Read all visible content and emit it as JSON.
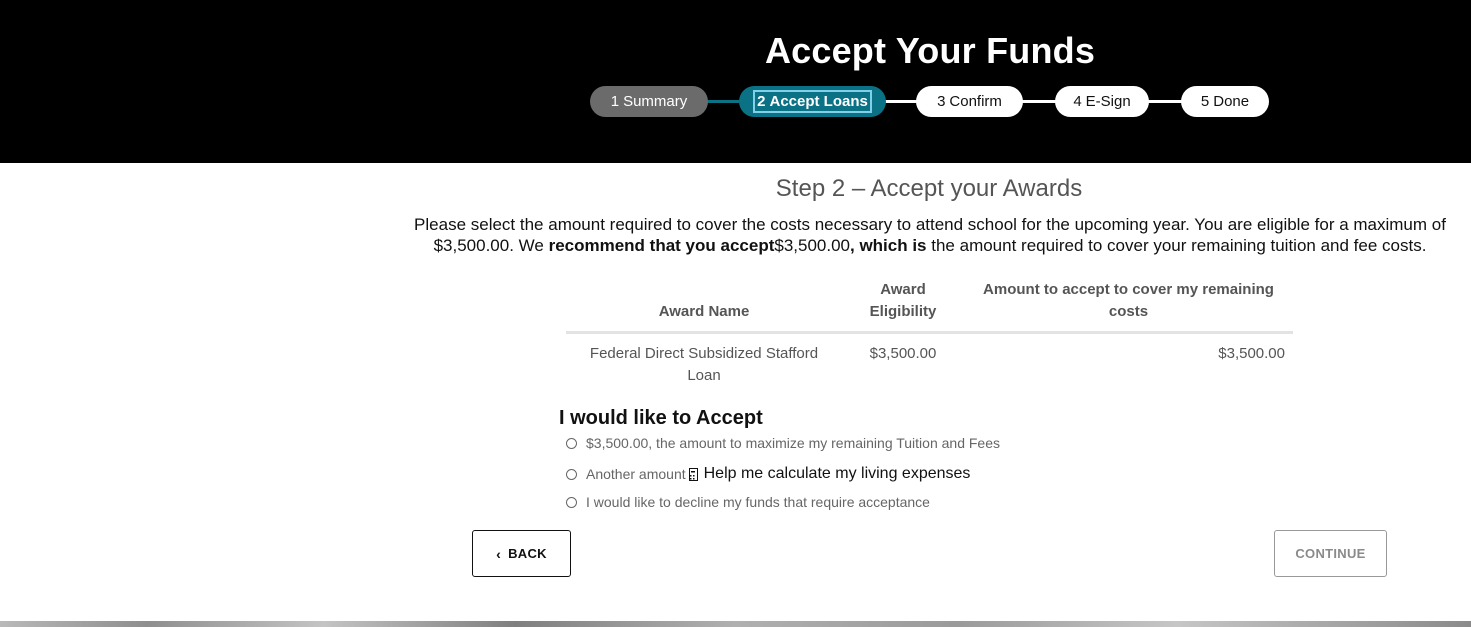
{
  "header": {
    "title": "Accept Your Funds",
    "steps": [
      {
        "number": "1",
        "label": "Summary",
        "state": "completed"
      },
      {
        "number": "2",
        "label": "Accept Loans",
        "state": "current"
      },
      {
        "number": "3",
        "label": "Confirm",
        "state": "upcoming"
      },
      {
        "number": "4",
        "label": "E-Sign",
        "state": "upcoming"
      },
      {
        "number": "5",
        "label": "Done",
        "state": "upcoming"
      }
    ]
  },
  "main": {
    "step_heading": "Step 2 – Accept your Awards",
    "intro": {
      "part1": "Please select the amount required to cover the costs necessary to attend school for the upcoming year. You are eligible for a maximum of $3,500.00.  We ",
      "bold1": "recommend that you accept",
      "part2": "$3,500.00",
      "bold2": ", which is",
      "part3": " the amount required to cover your remaining tuition and fee costs."
    },
    "table": {
      "headers": [
        "Award Name",
        "Award Eligibility",
        "Amount to accept to cover my remaining costs"
      ],
      "rows": [
        {
          "name": "Federal Direct Subsidized Stafford Loan",
          "eligibility": "$3,500.00",
          "amount": "$3,500.00"
        }
      ]
    },
    "accept_heading": "I would like to Accept",
    "options": [
      {
        "label": "$3,500.00, the amount to maximize my remaining Tuition and Fees",
        "selected": false
      },
      {
        "label": "Another amount",
        "link": "Help me calculate my living expenses",
        "selected": false
      },
      {
        "label": "I would like to decline my funds that require acceptance",
        "selected": false
      }
    ]
  },
  "buttons": {
    "back": "BACK",
    "continue": "CONTINUE"
  },
  "colors": {
    "header_bg": "#000000",
    "step_completed": "#6b6b6b",
    "step_current": "#0b7285",
    "step_upcoming": "#ffffff"
  }
}
